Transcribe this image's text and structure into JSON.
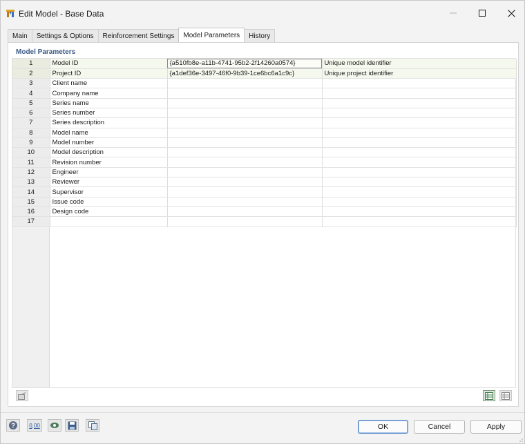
{
  "window": {
    "title": "Edit Model - Base Data"
  },
  "tabs": [
    {
      "label": "Main"
    },
    {
      "label": "Settings & Options"
    },
    {
      "label": "Reinforcement Settings"
    },
    {
      "label": "Model Parameters",
      "active": true
    },
    {
      "label": "History"
    }
  ],
  "panel": {
    "section_title": "Model Parameters"
  },
  "rows": [
    {
      "num": "1",
      "name": "Model ID",
      "value": "{a510fb8e-a11b-4741-95b2-2f14260a0574}",
      "desc": "Unique model identifier"
    },
    {
      "num": "2",
      "name": "Project ID",
      "value": "{a1def36e-3497-46f0-9b39-1ce6bc6a1c9c}",
      "desc": "Unique project identifier"
    },
    {
      "num": "3",
      "name": "Client name",
      "value": "",
      "desc": ""
    },
    {
      "num": "4",
      "name": "Company name",
      "value": "",
      "desc": ""
    },
    {
      "num": "5",
      "name": "Series name",
      "value": "",
      "desc": ""
    },
    {
      "num": "6",
      "name": "Series number",
      "value": "",
      "desc": ""
    },
    {
      "num": "7",
      "name": "Series description",
      "value": "",
      "desc": ""
    },
    {
      "num": "8",
      "name": "Model name",
      "value": "",
      "desc": ""
    },
    {
      "num": "9",
      "name": "Model number",
      "value": "",
      "desc": ""
    },
    {
      "num": "10",
      "name": "Model description",
      "value": "",
      "desc": ""
    },
    {
      "num": "11",
      "name": "Revision number",
      "value": "",
      "desc": ""
    },
    {
      "num": "12",
      "name": "Engineer",
      "value": "",
      "desc": ""
    },
    {
      "num": "13",
      "name": "Reviewer",
      "value": "",
      "desc": ""
    },
    {
      "num": "14",
      "name": "Supervisor",
      "value": "",
      "desc": ""
    },
    {
      "num": "15",
      "name": "Issue code",
      "value": "",
      "desc": ""
    },
    {
      "num": "16",
      "name": "Design code",
      "value": "",
      "desc": ""
    },
    {
      "num": "17",
      "name": "",
      "value": "",
      "desc": ""
    }
  ],
  "footer": {
    "ok_label": "OK",
    "cancel_label": "Cancel",
    "apply_label": "Apply",
    "units_label": "0,00"
  },
  "colors": {
    "section_title": "#3d5a86",
    "ok_border": "#4b7fc1"
  }
}
